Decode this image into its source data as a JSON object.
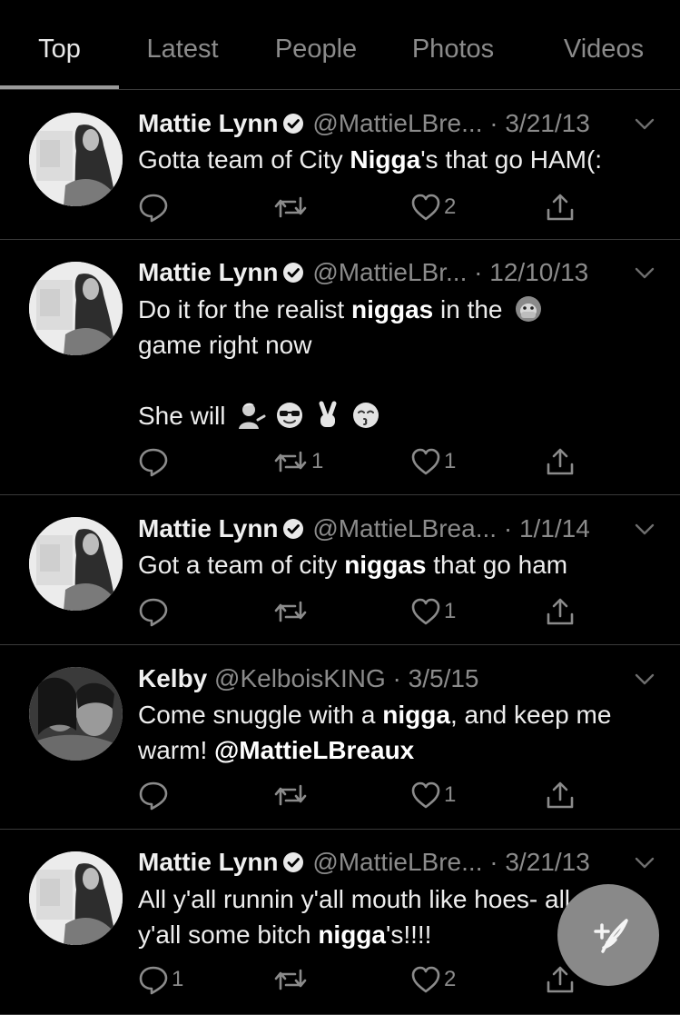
{
  "tabs": [
    "Top",
    "Latest",
    "People",
    "Photos",
    "Videos"
  ],
  "active_tab": "Top",
  "tweets": [
    {
      "name": "Mattie Lynn",
      "verified": true,
      "handle": "@MattieLBre...",
      "date": "3/21/13",
      "lines": [
        [
          {
            "t": "Gotta team of City "
          },
          {
            "t": "Nigga",
            "b": true
          },
          {
            "t": "'s that go HAM(:"
          }
        ]
      ],
      "replies": "",
      "retweets": "",
      "likes": "2"
    },
    {
      "name": "Mattie Lynn",
      "verified": true,
      "handle": "@MattieLBr...",
      "date": "12/10/13",
      "lines": [
        [
          {
            "t": "Do it for the realist "
          },
          {
            "t": "niggas",
            "b": true
          },
          {
            "t": " in the "
          },
          {
            "emoji": "speak-no-evil-monkey"
          }
        ],
        [
          {
            "t": "game right now"
          }
        ],
        [],
        [
          {
            "t": "She will "
          },
          {
            "emoji": "person-tipping-hand"
          },
          {
            "emoji": "smiling-face-sunglasses"
          },
          {
            "emoji": "victory-hand"
          },
          {
            "emoji": "kissing-face"
          }
        ]
      ],
      "replies": "",
      "retweets": "1",
      "likes": "1"
    },
    {
      "name": "Mattie Lynn",
      "verified": true,
      "handle": "@MattieLBrea...",
      "date": "1/1/14",
      "lines": [
        [
          {
            "t": "Got a team of city "
          },
          {
            "t": "niggas",
            "b": true
          },
          {
            "t": " that go ham"
          }
        ]
      ],
      "replies": "",
      "retweets": "",
      "likes": "1"
    },
    {
      "name": "Kelby",
      "verified": false,
      "handle": "@KelboisKING",
      "date": "3/5/15",
      "lines": [
        [
          {
            "t": "Come snuggle with a "
          },
          {
            "t": "nigga",
            "b": true
          },
          {
            "t": ", and keep me"
          }
        ],
        [
          {
            "t": "warm! "
          },
          {
            "t": "@MattieLBreaux",
            "b": true
          }
        ]
      ],
      "replies": "",
      "retweets": "",
      "likes": "1"
    },
    {
      "name": "Mattie Lynn",
      "verified": true,
      "handle": "@MattieLBre...",
      "date": "3/21/13",
      "lines": [
        [
          {
            "t": "All y'all runnin y'all mouth like hoes- all"
          }
        ],
        [
          {
            "t": "y'all some bitch "
          },
          {
            "t": "nigga",
            "b": true
          },
          {
            "t": "'s!!!!"
          }
        ]
      ],
      "replies": "1",
      "retweets": "",
      "likes": "2"
    }
  ],
  "icons": {
    "reply": "reply-icon",
    "retweet": "retweet-icon",
    "like": "heart-icon",
    "share": "share-icon",
    "compose": "compose-tweet-icon",
    "more": "chevron-down-icon",
    "verified": "verified-badge-icon"
  }
}
